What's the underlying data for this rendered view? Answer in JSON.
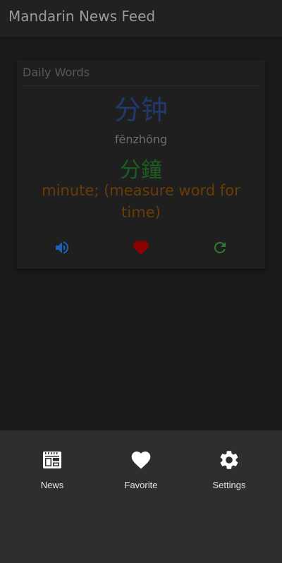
{
  "app_bar": {
    "title": "Mandarin News Feed"
  },
  "daily_words": {
    "title": "Daily Words",
    "simplified": "分钟",
    "pinyin": "fēnzhōng",
    "traditional": "分鐘",
    "definition": "minute; (measure word for time)",
    "actions": [
      {
        "icon": "speaker-icon",
        "color": "#1565c0"
      },
      {
        "icon": "heart-icon",
        "color": "#8b0000"
      },
      {
        "icon": "refresh-icon",
        "color": "#2e7d32"
      }
    ]
  },
  "bottom_nav": {
    "items": [
      {
        "label": "News",
        "icon": "news-icon"
      },
      {
        "label": "Favorite",
        "icon": "heart-icon"
      },
      {
        "label": "Settings",
        "icon": "gear-icon"
      }
    ]
  }
}
